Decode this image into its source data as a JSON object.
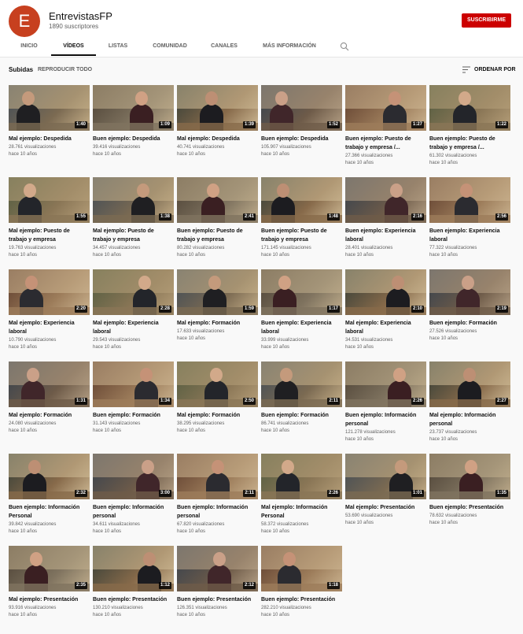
{
  "channel": {
    "avatar_letter": "E",
    "name": "EntrevistasFP",
    "subscribers": "1890 suscriptores",
    "subscribe_label": "SUSCRIBIRME",
    "avatar_color": "#c7401f",
    "subscribe_color": "#cc0000"
  },
  "tabs": [
    {
      "label": "INICIO",
      "active": false
    },
    {
      "label": "VÍDEOS",
      "active": true
    },
    {
      "label": "LISTAS",
      "active": false
    },
    {
      "label": "COMUNIDAD",
      "active": false
    },
    {
      "label": "CANALES",
      "active": false
    },
    {
      "label": "MÁS INFORMACIÓN",
      "active": false
    }
  ],
  "search_icon": "search-icon",
  "section": {
    "title": "Subidas",
    "play_all_label": "REPRODUCIR TODO",
    "sort_label": "ORDENAR POR",
    "sort_icon": "sort-icon"
  },
  "videos": [
    {
      "title": "Mal ejemplo: Despedida",
      "duration": "1:40",
      "views": "28.761 visualizaciones",
      "age": "hace 10 años"
    },
    {
      "title": "Buen ejemplo: Despedida",
      "duration": "1:09",
      "views": "39.416 visualizaciones",
      "age": "hace 10 años"
    },
    {
      "title": "Mal ejemplo: Despedida",
      "duration": "1:39",
      "views": "40.741 visualizaciones",
      "age": "hace 10 años"
    },
    {
      "title": "Buen ejemplo: Despedida",
      "duration": "1:52",
      "views": "105.907 visualizaciones",
      "age": "hace 10 años"
    },
    {
      "title": "Buen ejemplo: Puesto de trabajo y empresa /...",
      "duration": "1:27",
      "views": "27.366 visualizaciones",
      "age": "hace 10 años"
    },
    {
      "title": "Buen ejemplo: Puesto de trabajo y empresa /...",
      "duration": "1:22",
      "views": "61.302 visualizaciones",
      "age": "hace 10 años"
    },
    {
      "title": "Mal ejemplo: Puesto de trabajo y empresa",
      "duration": "1:55",
      "views": "19.763 visualizaciones",
      "age": "hace 10 años"
    },
    {
      "title": "Mal ejemplo: Puesto de trabajo y empresa",
      "duration": "1:38",
      "views": "34.457 visualizaciones",
      "age": "hace 10 años"
    },
    {
      "title": "Buen ejemplo: Puesto de trabajo y empresa",
      "duration": "2:41",
      "views": "80.282 visualizaciones",
      "age": "hace 10 años"
    },
    {
      "title": "Buen ejemplo: Puesto de trabajo y empresa",
      "duration": "1:48",
      "views": "171.145 visualizaciones",
      "age": "hace 10 años"
    },
    {
      "title": "Buen ejemplo: Experiencia laboral",
      "duration": "2:16",
      "views": "28.401 visualizaciones",
      "age": "hace 10 años"
    },
    {
      "title": "Buen ejemplo: Experiencia laboral",
      "duration": "2:56",
      "views": "77.322 visualizaciones",
      "age": "hace 10 años"
    },
    {
      "title": "Mal ejemplo: Experiencia laboral",
      "duration": "2:20",
      "views": "10.790 visualizaciones",
      "age": "hace 10 años"
    },
    {
      "title": "Mal ejemplo: Experiencia laboral",
      "duration": "2:28",
      "views": "29.543 visualizaciones",
      "age": "hace 10 años"
    },
    {
      "title": "Mal ejemplo: Formación",
      "duration": "1:59",
      "views": "17.633 visualizaciones",
      "age": "hace 10 años"
    },
    {
      "title": "Buen ejemplo: Experiencia laboral",
      "duration": "1:17",
      "views": "33.999 visualizaciones",
      "age": "hace 10 años"
    },
    {
      "title": "Mal ejemplo: Experiencia laboral",
      "duration": "2:10",
      "views": "34.531 visualizaciones",
      "age": "hace 10 años"
    },
    {
      "title": "Buen ejemplo: Formación",
      "duration": "2:19",
      "views": "27.526 visualizaciones",
      "age": "hace 10 años"
    },
    {
      "title": "Mal ejemplo: Formación",
      "duration": "1:31",
      "views": "24.080 visualizaciones",
      "age": "hace 10 años"
    },
    {
      "title": "Buen ejemplo: Formación",
      "duration": "1:34",
      "views": "31.143 visualizaciones",
      "age": "hace 10 años"
    },
    {
      "title": "Mal ejemplo: Formación",
      "duration": "2:50",
      "views": "38.295 visualizaciones",
      "age": "hace 10 años"
    },
    {
      "title": "Buen ejemplo: Formación",
      "duration": "2:11",
      "views": "86.741 visualizaciones",
      "age": "hace 10 años"
    },
    {
      "title": "Buen ejemplo: Información personal",
      "duration": "2:26",
      "views": "121.278 visualizaciones",
      "age": "hace 10 años"
    },
    {
      "title": "Mal ejemplo: Información personal",
      "duration": "2:27",
      "views": "23.737 visualizaciones",
      "age": "hace 10 años"
    },
    {
      "title": "Buen ejemplo: Información Personal",
      "duration": "2:32",
      "views": "39.842 visualizaciones",
      "age": "hace 10 años"
    },
    {
      "title": "Buen ejemplo: Información personal",
      "duration": "3:00",
      "views": "34.611 visualizaciones",
      "age": "hace 10 años"
    },
    {
      "title": "Buen ejemplo: Información personal",
      "duration": "2:11",
      "views": "67.820 visualizaciones",
      "age": "hace 10 años"
    },
    {
      "title": "Mal ejemplo: Información Personal",
      "duration": "2:26",
      "views": "58.372 visualizaciones",
      "age": "hace 10 años"
    },
    {
      "title": "Mal ejemplo: Presentación",
      "duration": "1:01",
      "views": "53.690 visualizaciones",
      "age": "hace 10 años"
    },
    {
      "title": "Buen ejemplo: Presentación",
      "duration": "1:35",
      "views": "78.632 visualizaciones",
      "age": "hace 10 años"
    },
    {
      "title": "Mal ejemplo: Presentación",
      "duration": "2:35",
      "views": "93.916 visualizaciones",
      "age": "hace 10 años"
    },
    {
      "title": "Buen ejemplo: Presentación",
      "duration": "1:12",
      "views": "130.210 visualizaciones",
      "age": "hace 10 años"
    },
    {
      "title": "Buen ejemplo: Presentación",
      "duration": "2:12",
      "views": "126.351 visualizaciones",
      "age": "hace 10 años"
    },
    {
      "title": "Buen ejemplo: Presentación",
      "duration": "1:18",
      "views": "282.210 visualizaciones",
      "age": "hace 10 años"
    }
  ]
}
